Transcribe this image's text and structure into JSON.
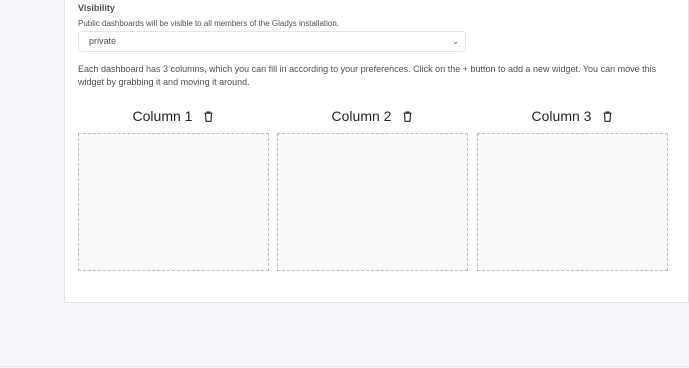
{
  "visibility": {
    "label": "Visibility",
    "help": "Public dashboards will be visible to all members of the Gladys installation.",
    "selected": "private"
  },
  "description": "Each dashboard has 3 columns, which you can fill in according to your preferences. Click on the + button to add a new widget. You can move this widget by grabbing it and moving it around.",
  "columns": [
    {
      "title": "Column 1",
      "icon": "trash-icon"
    },
    {
      "title": "Column 2",
      "icon": "trash-icon"
    },
    {
      "title": "Column 3",
      "icon": "trash-icon"
    }
  ]
}
